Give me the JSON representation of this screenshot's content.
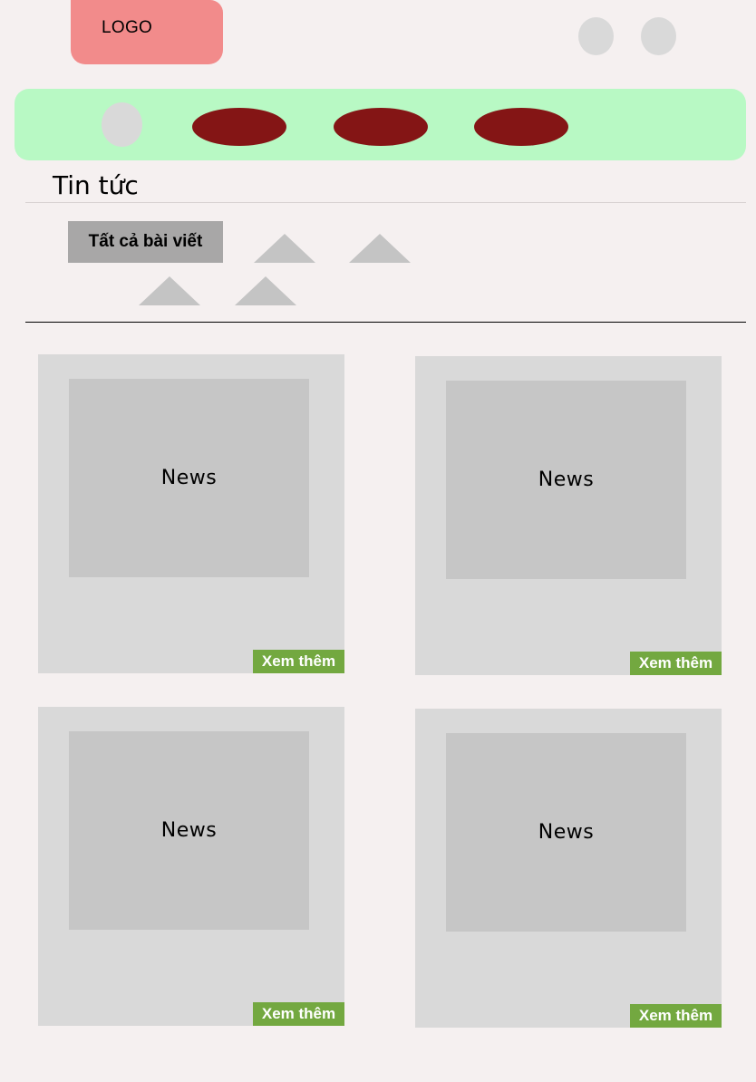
{
  "header": {
    "logo_text": "LOGO",
    "icons": [
      "user-icon",
      "cart-icon"
    ]
  },
  "nav": {
    "home_icon": "home-icon",
    "items": [
      "",
      "",
      ""
    ]
  },
  "section": {
    "title": "Tin tức"
  },
  "filters": {
    "all_label": "Tất cả bài viết"
  },
  "cards": [
    {
      "thumb_label": "News",
      "more_label": "Xem thêm"
    },
    {
      "thumb_label": "News",
      "more_label": "Xem thêm"
    },
    {
      "thumb_label": "News",
      "more_label": "Xem thêm"
    },
    {
      "thumb_label": "News",
      "more_label": "Xem thêm"
    }
  ],
  "colors": {
    "background": "#f5f0f0",
    "logo": "#f28b8b",
    "navbar": "#b8f9c4",
    "nav_pill": "#841515",
    "placeholder": "#d9d9d9",
    "filter_active": "#a8a7a7",
    "more_button": "#73a840"
  }
}
